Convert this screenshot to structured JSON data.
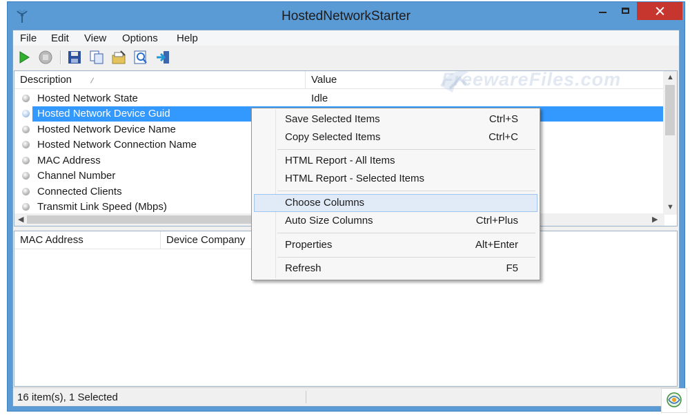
{
  "window": {
    "title": "HostedNetworkStarter"
  },
  "menubar": {
    "items": [
      "File",
      "Edit",
      "View",
      "Options",
      "Help"
    ]
  },
  "toolbar": {
    "icons": [
      "start-icon",
      "stop-icon",
      "save-icon",
      "copy-icon",
      "properties-icon",
      "html-report-icon",
      "exit-icon"
    ]
  },
  "upper_table": {
    "columns": [
      "Description",
      "Value"
    ],
    "rows": [
      {
        "description": "Hosted Network State",
        "value": "Idle",
        "selected": false
      },
      {
        "description": "Hosted Network Device Guid",
        "value": "",
        "selected": true
      },
      {
        "description": "Hosted Network Device Name",
        "value": "",
        "selected": false
      },
      {
        "description": "Hosted Network Connection Name",
        "value": "",
        "selected": false
      },
      {
        "description": "MAC Address",
        "value": "",
        "selected": false
      },
      {
        "description": "Channel Number",
        "value": "",
        "selected": false
      },
      {
        "description": "Connected Clients",
        "value": "",
        "selected": false
      },
      {
        "description": "Transmit Link Speed (Mbps)",
        "value": "",
        "selected": false
      }
    ]
  },
  "lower_table": {
    "columns": [
      "MAC Address",
      "Device Company"
    ]
  },
  "context_menu": {
    "items": [
      {
        "label": "Save Selected Items",
        "shortcut": "Ctrl+S"
      },
      {
        "label": "Copy Selected Items",
        "shortcut": "Ctrl+C"
      },
      {
        "label": "HTML Report - All Items",
        "shortcut": ""
      },
      {
        "label": "HTML Report - Selected Items",
        "shortcut": ""
      },
      {
        "label": "Choose Columns",
        "shortcut": ""
      },
      {
        "label": "Auto Size Columns",
        "shortcut": "Ctrl+Plus"
      },
      {
        "label": "Properties",
        "shortcut": "Alt+Enter"
      },
      {
        "label": "Refresh",
        "shortcut": "F5"
      }
    ],
    "highlighted": "Choose Columns"
  },
  "statusbar": {
    "text": "16 item(s), 1 Selected"
  },
  "watermark": {
    "text": "FreewareFiles.com"
  },
  "colors": {
    "selection": "#3399ff",
    "close_button": "#c7352f",
    "titlebar": "#5b9bd5"
  }
}
